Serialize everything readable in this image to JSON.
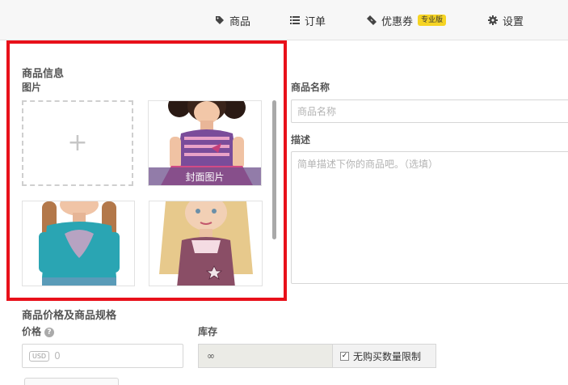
{
  "nav": {
    "products": "商品",
    "orders": "订单",
    "coupons": "优惠券",
    "pro_badge": "专业版",
    "settings": "设置"
  },
  "product_info": {
    "title": "商品信息",
    "images_label": "图片",
    "add_symbol": "+",
    "cover_label": "封面图片"
  },
  "name_field": {
    "label": "商品名称",
    "placeholder": "商品名称"
  },
  "desc_field": {
    "label": "描述",
    "placeholder": "简单描述下你的商品吧。（选填）"
  },
  "pricing": {
    "title": "商品价格及商品规格",
    "price_label": "价格",
    "help_symbol": "?",
    "currency": "USD",
    "price_placeholder": "0",
    "stock_label": "库存",
    "stock_value": "∞",
    "unlimited_label": "无购买数量限制",
    "unlimited_checked": "✓"
  },
  "icons": {
    "products": "tag-icon",
    "orders": "list-icon",
    "coupons": "ticket-icon",
    "settings": "gear-icon"
  },
  "colors": {
    "highlight": "#e8101a",
    "badge": "#f6d423"
  }
}
